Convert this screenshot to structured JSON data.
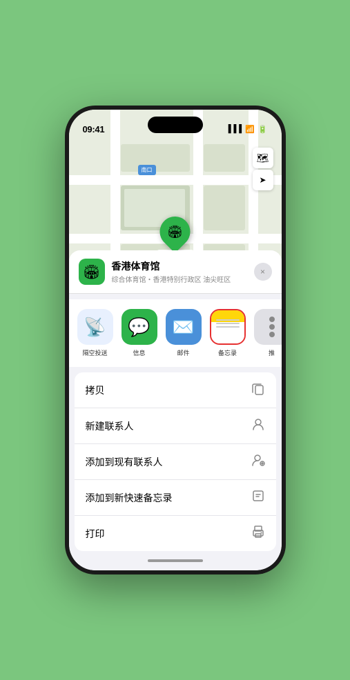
{
  "status_bar": {
    "time": "09:41",
    "signal": "●●●",
    "wifi": "WiFi",
    "battery": "Battery"
  },
  "map": {
    "label": "南口",
    "controls": {
      "map_icon": "🗺",
      "location_icon": "↗"
    },
    "pin": {
      "label": "香港体育馆",
      "emoji": "🏟"
    }
  },
  "venue": {
    "name": "香港体育馆",
    "description": "综合体育馆・香港特别行政区 油尖旺区",
    "icon": "🏟"
  },
  "close_button": "×",
  "share_actions": [
    {
      "id": "airdrop",
      "label": "隔空投送",
      "type": "airdrop"
    },
    {
      "id": "messages",
      "label": "信息",
      "type": "messages"
    },
    {
      "id": "mail",
      "label": "邮件",
      "type": "mail"
    },
    {
      "id": "notes",
      "label": "备忘录",
      "type": "notes"
    }
  ],
  "action_list": [
    {
      "id": "copy",
      "label": "拷贝",
      "icon": "⎘"
    },
    {
      "id": "new-contact",
      "label": "新建联系人",
      "icon": "👤"
    },
    {
      "id": "add-existing",
      "label": "添加到现有联系人",
      "icon": "👤"
    },
    {
      "id": "add-note",
      "label": "添加到新快速备忘录",
      "icon": "📝"
    },
    {
      "id": "print",
      "label": "打印",
      "icon": "🖨"
    }
  ]
}
